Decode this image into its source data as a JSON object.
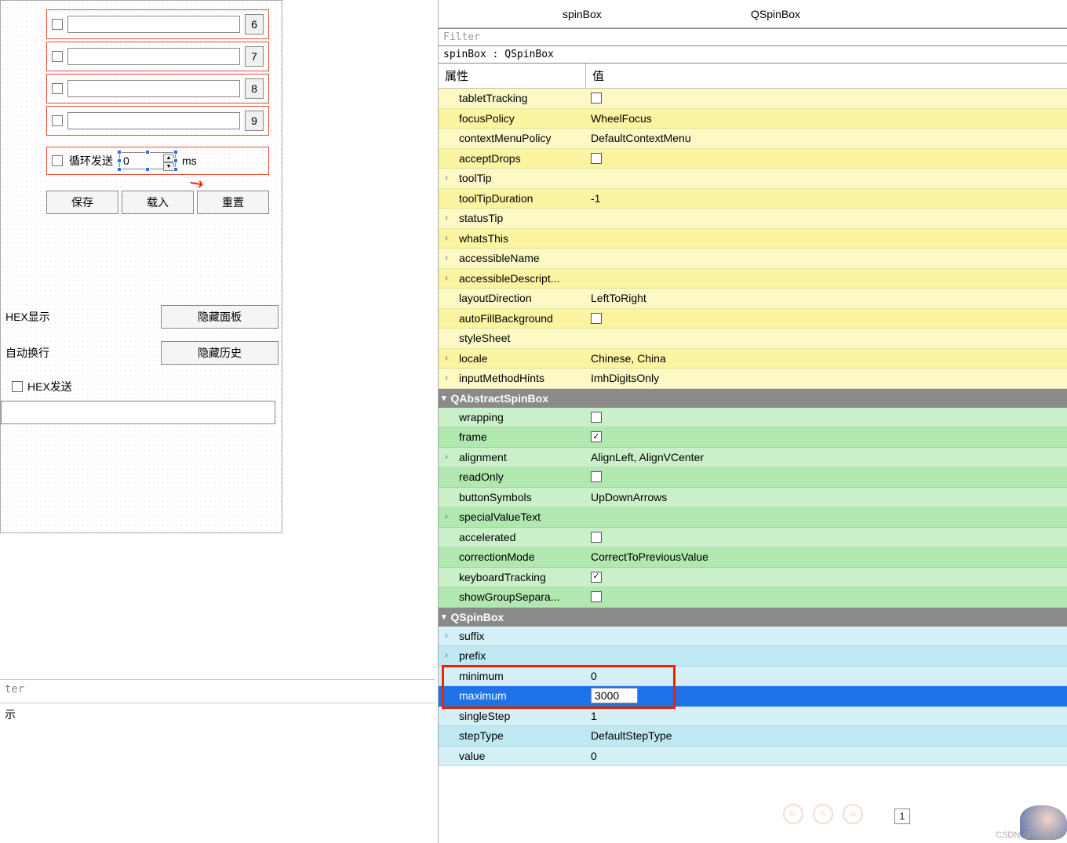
{
  "designer": {
    "rows": [
      {
        "num": "6"
      },
      {
        "num": "7"
      },
      {
        "num": "8"
      },
      {
        "num": "9"
      }
    ],
    "loop": {
      "label": "循环发送",
      "value": "0",
      "unit": "ms"
    },
    "buttons": {
      "save": "保存",
      "load": "载入",
      "reset": "重置"
    },
    "opts": {
      "hex_display": "HEX显示",
      "auto_wrap": "自动换行",
      "hide_panel": "隐藏面板",
      "hide_history": "隐藏历史",
      "hex_send": "HEX发送"
    }
  },
  "bottom": {
    "filter": "ter",
    "row2": "示"
  },
  "tree": {
    "name": "spinBox",
    "class": "QSpinBox"
  },
  "filter_placeholder": "Filter",
  "object_path": "spinBox : QSpinBox",
  "headers": {
    "prop": "属性",
    "val": "值"
  },
  "qwidget": [
    {
      "n": "tabletTracking",
      "v": "",
      "chk": false,
      "exp": ""
    },
    {
      "n": "focusPolicy",
      "v": "WheelFocus",
      "exp": ""
    },
    {
      "n": "contextMenuPolicy",
      "v": "DefaultContextMenu",
      "exp": ""
    },
    {
      "n": "acceptDrops",
      "v": "",
      "chk": false,
      "exp": ""
    },
    {
      "n": "toolTip",
      "v": "",
      "exp": "›"
    },
    {
      "n": "toolTipDuration",
      "v": "-1",
      "exp": ""
    },
    {
      "n": "statusTip",
      "v": "",
      "exp": "›"
    },
    {
      "n": "whatsThis",
      "v": "",
      "exp": "›"
    },
    {
      "n": "accessibleName",
      "v": "",
      "exp": "›"
    },
    {
      "n": "accessibleDescript...",
      "v": "",
      "exp": "›"
    },
    {
      "n": "layoutDirection",
      "v": "LeftToRight",
      "exp": ""
    },
    {
      "n": "autoFillBackground",
      "v": "",
      "chk": false,
      "exp": ""
    },
    {
      "n": "styleSheet",
      "v": "",
      "exp": ""
    },
    {
      "n": "locale",
      "v": "Chinese, China",
      "exp": "›"
    },
    {
      "n": "inputMethodHints",
      "v": "ImhDigitsOnly",
      "exp": "›"
    }
  ],
  "section_abstract": "QAbstractSpinBox",
  "qabstract": [
    {
      "n": "wrapping",
      "v": "",
      "chk": false,
      "exp": ""
    },
    {
      "n": "frame",
      "v": "",
      "chk": true,
      "exp": ""
    },
    {
      "n": "alignment",
      "v": "AlignLeft, AlignVCenter",
      "exp": "›"
    },
    {
      "n": "readOnly",
      "v": "",
      "chk": false,
      "exp": ""
    },
    {
      "n": "buttonSymbols",
      "v": "UpDownArrows",
      "exp": ""
    },
    {
      "n": "specialValueText",
      "v": "",
      "exp": "›"
    },
    {
      "n": "accelerated",
      "v": "",
      "chk": false,
      "exp": ""
    },
    {
      "n": "correctionMode",
      "v": "CorrectToPreviousValue",
      "exp": ""
    },
    {
      "n": "keyboardTracking",
      "v": "",
      "chk": true,
      "exp": ""
    },
    {
      "n": "showGroupSepara...",
      "v": "",
      "chk": false,
      "exp": ""
    }
  ],
  "section_spinbox": "QSpinBox",
  "qspinbox": [
    {
      "n": "suffix",
      "v": "",
      "exp": "›"
    },
    {
      "n": "prefix",
      "v": "",
      "exp": "›"
    },
    {
      "n": "minimum",
      "v": "0",
      "exp": ""
    },
    {
      "n": "maximum",
      "v": "3000",
      "exp": "",
      "selected": true,
      "editing": true
    },
    {
      "n": "singleStep",
      "v": "1",
      "exp": ""
    },
    {
      "n": "stepType",
      "v": "DefaultStepType",
      "exp": ""
    },
    {
      "n": "value",
      "v": "0",
      "exp": ""
    }
  ],
  "badge": "1",
  "watermark": "CSDN @mx_jun"
}
